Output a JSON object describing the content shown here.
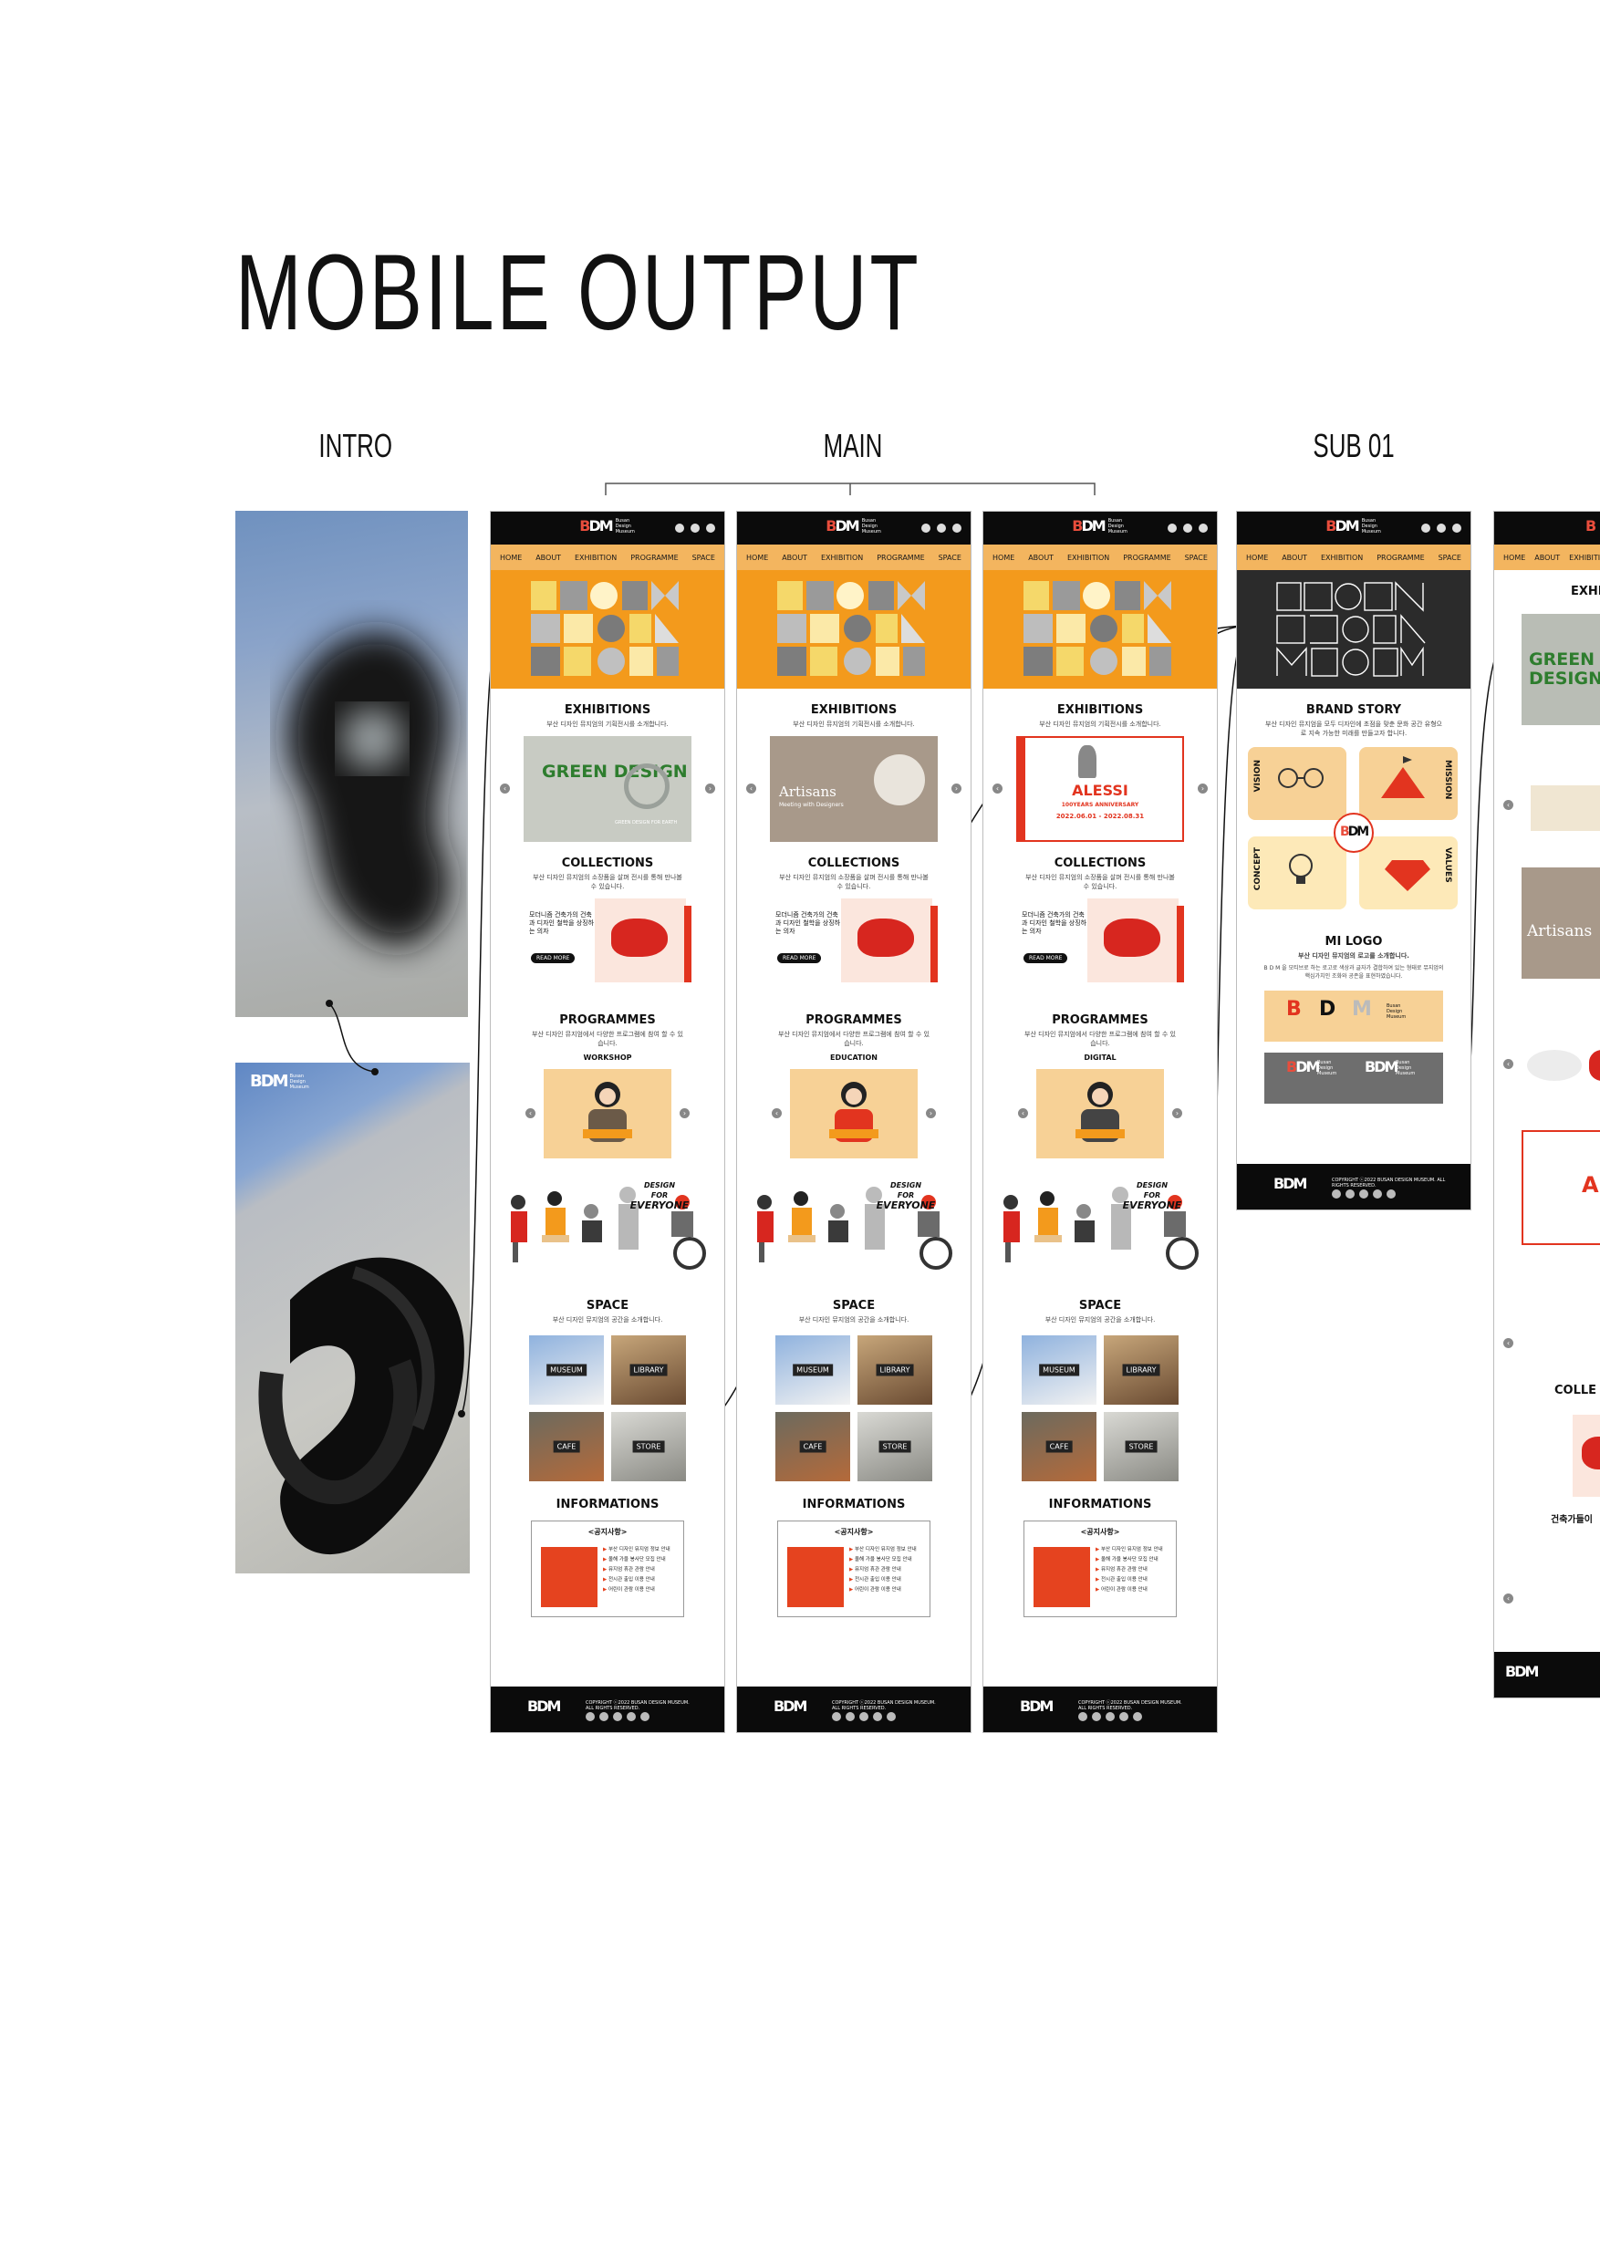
{
  "page_title": "MOBILE OUTPUT",
  "column_labels": {
    "intro": "INTRO",
    "main": "MAIN",
    "sub01": "SUB 01"
  },
  "logo": {
    "mark_a": "B",
    "mark_b": "DM",
    "words": "Busan Design Museum"
  },
  "nav": [
    "HOME",
    "ABOUT",
    "EXHIBITION",
    "PROGRAMME",
    "SPACE"
  ],
  "sections": {
    "exhibitions": "EXHIBITIONS",
    "exhibitions_sub": "부산 디자인 뮤지엄의 기획전시를 소개합니다.",
    "collections": "COLLECTIONS",
    "collections_sub": "부산 디자인 뮤지엄의 소장품을 살펴 전시를 통해 만나볼 수 있습니다.",
    "collections_text": "모더니즘 건축가의 건축과 디자인 철학을 상징하는 의자",
    "read_more": "READ MORE",
    "programmes": "PROGRAMMES",
    "programmes_sub": "부산 디자인 뮤지엄에서 다양한 프로그램에 참여 할 수 있습니다.",
    "space": "SPACE",
    "space_sub": "부산 디자인 뮤지엄의 공간을 소개합니다.",
    "informations": "INFORMATIONS",
    "notice": "<공지사항>"
  },
  "screens": [
    {
      "exhibit": "GREEN DESIGN",
      "exhibit_sub": "GREEN DESIGN FOR EARTH",
      "programme": "WORKSHOP"
    },
    {
      "exhibit": "Artisans",
      "exhibit_sub": "Meeting with Designers",
      "programme": "EDUCATION"
    },
    {
      "exhibit": "ALESSI",
      "exhibit_sub": "100YEARS ANNIVERSARY",
      "exhibit_date": "2022.06.01 - 2022.08.31",
      "programme": "DIGITAL"
    }
  ],
  "design_for_everyone": [
    "DESIGN",
    "FOR",
    "EVERYONE"
  ],
  "space_tiles": [
    "MUSEUM",
    "LIBRARY",
    "CAFE",
    "STORE"
  ],
  "notices": [
    "부산 디자인 뮤지엄 정보 안내",
    "올해 가을 봉사단 모집 안내",
    "뮤지엄 휴관 관람 안내",
    "전시관 출입 이용 안내",
    "어린이 관람 이용 안내"
  ],
  "footer": {
    "copyright": "COPYRIGHT ⓒ2022 BUSAN DESIGN MUSEUM. ALL RIGHTS RESERVED."
  },
  "sub01": {
    "brand_story": "BRAND STORY",
    "brand_story_sub": "부산 디자인 뮤지엄을 모두 디자인에 초점을 맞춘 문화 공간 유형으로 지속 가능한 미래를 만들고자 합니다.",
    "cards": [
      "VISION",
      "MISSION",
      "CONCEPT",
      "VALUES"
    ],
    "mi_logo": "MI LOGO",
    "mi_logo_sub": "부산 디자인 뮤지엄의 로고를 소개합니다.",
    "mi_logo_desc": "B D M 을 모티브로 하는 로고로 색상과 글자가 결합하여 있는 형태로 뮤지엄의 핵심가치인 조화와 공존을 표현하였습니다."
  },
  "sub02": {
    "exhibition_head": "EXHI",
    "green": "GREEN DESIGN",
    "artisans": "Artisans",
    "alessi": "AL",
    "collections_head": "COLLE",
    "chair_caption": "건축가들이"
  },
  "colors": {
    "orange": "#f39a1c",
    "nav": "#f3b55f",
    "cream": "#f7d196",
    "red": "#e2341f",
    "black": "#0b0b0b"
  }
}
